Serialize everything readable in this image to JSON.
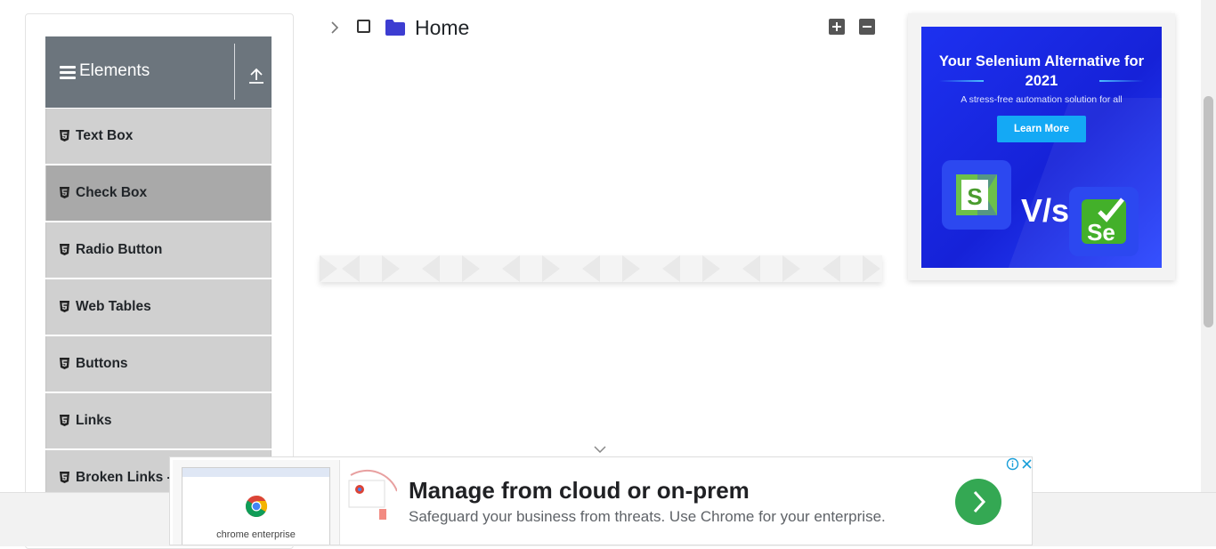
{
  "sidebar": {
    "group_title": "Elements",
    "items": [
      {
        "label": "Text Box"
      },
      {
        "label": "Check Box"
      },
      {
        "label": "Radio Button"
      },
      {
        "label": "Web Tables"
      },
      {
        "label": "Buttons"
      },
      {
        "label": "Links"
      },
      {
        "label": "Broken Links -"
      }
    ],
    "active_index": 1
  },
  "tree": {
    "root_label": "Home"
  },
  "side_ad": {
    "headline": "Your Selenium Alternative for 2021",
    "subline": "A stress-free automation solution for all",
    "cta": "Learn More",
    "versus": "V/s",
    "left_logo": "S",
    "right_logo": "Se"
  },
  "bottom_ad": {
    "brand": "chrome enterprise",
    "headline": "Manage from cloud or on-prem",
    "description": "Safeguard your business from threats. Use Chrome for your enterprise."
  },
  "colors": {
    "header_gray": "#6c757d",
    "menu_item": "#d0d0d0",
    "menu_item_active": "#a9a9a9",
    "folder_blue": "#3d3dd1",
    "ad_blue": "#1d31f0",
    "ad_cta": "#14a9f5",
    "go_green": "#34a853"
  },
  "icons": {
    "menu": "hamburger-icon",
    "collapse_group": "upload-icon",
    "item": "html5-icon",
    "tree_toggle": "chevron-right-icon",
    "folder": "folder-icon",
    "expand_all": "plus-square-icon",
    "collapse_all": "minus-square-icon"
  }
}
